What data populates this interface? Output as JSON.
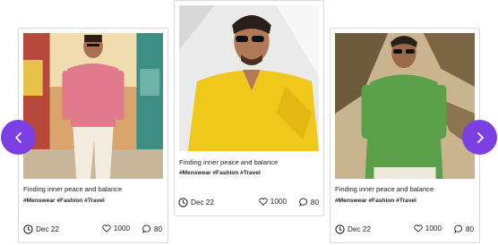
{
  "carousel": {
    "cards": [
      {
        "caption": "Finding inner peace and balance",
        "tags": "#Menswear #Fashion #Travel",
        "date": "Dec 22",
        "likes": "1000",
        "comments": "80",
        "shirt_color": "#e07a8c",
        "scene": "street"
      },
      {
        "caption": "Finding inner peace and balance",
        "tags": "#Menswear #Fashion #Travel",
        "date": "Dec 22",
        "likes": "1000",
        "comments": "80",
        "shirt_color": "#f0c81c",
        "scene": "sun"
      },
      {
        "caption": "Finding inner peace and balance",
        "tags": "#Menswear #Fashion #Travel",
        "date": "Dec 22",
        "likes": "1000",
        "comments": "80",
        "shirt_color": "#5aa04a",
        "scene": "palms"
      }
    ]
  },
  "colors": {
    "nav_button": "#7b3fe4"
  },
  "icons": {
    "prev": "chevron-left-icon",
    "next": "chevron-right-icon",
    "date": "clock-icon",
    "likes": "heart-icon",
    "comments": "comment-icon"
  }
}
